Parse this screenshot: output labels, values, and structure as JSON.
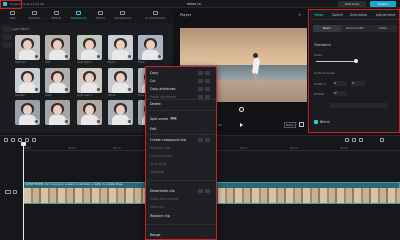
{
  "topbar": {
    "project_name": "Project name 12.22.02",
    "app_title": "DEMO (3)",
    "shortcuts_label": "Shortcuts",
    "export_label": "Export"
  },
  "toolbar": {
    "items": [
      {
        "label": "Text",
        "active": false
      },
      {
        "label": "Stickers",
        "active": false
      },
      {
        "label": "Effects",
        "active": false
      },
      {
        "label": "Transitions",
        "active": true
      },
      {
        "label": "Filters",
        "active": false
      },
      {
        "label": "Adjustment",
        "active": false
      },
      {
        "label": "AI Characters",
        "active": false
      }
    ]
  },
  "browser": {
    "category_title": "Light Effect",
    "items": [
      {
        "label": "Glamour"
      },
      {
        "label": "Halo"
      },
      {
        "label": "Light leak 1"
      },
      {
        "label": "Beam"
      },
      {
        "label": "Flash"
      },
      {
        "label": "Sparkle"
      },
      {
        "label": "Glow"
      },
      {
        "label": "Light leak 2"
      },
      {
        "label": "Shine"
      },
      {
        "label": "Flare"
      },
      {
        "label": ""
      },
      {
        "label": ""
      },
      {
        "label": ""
      },
      {
        "label": ""
      },
      {
        "label": ""
      }
    ]
  },
  "player": {
    "title": "Player",
    "timecode": "00:00:00:00 / 00:00:09:02",
    "ratio_label": "Ratio"
  },
  "inspector": {
    "tabs": [
      {
        "label": "Video",
        "active": true
      },
      {
        "label": "Speed",
        "active": false
      },
      {
        "label": "Animation",
        "active": false
      },
      {
        "label": "Adjustment",
        "active": false
      }
    ],
    "segments": [
      {
        "label": "Basic",
        "active": true
      },
      {
        "label": "Remove BG",
        "active": false
      },
      {
        "label": "Mask",
        "active": false
      }
    ],
    "transform_label": "Transform",
    "scale_label": "Scale",
    "scale_value": 1.0,
    "uniform_scale_label": "Uniform scale",
    "position_label": "Position",
    "position_x": "0",
    "position_y": "0",
    "rotate_label": "Rotate",
    "rotate_value": "0°",
    "blend_label": "Blend"
  },
  "timeline": {
    "ticks": [
      "00:00",
      "00:05",
      "00:10",
      "00:15",
      "00:20",
      "00:25"
    ],
    "clip_title": "SCENE MODEL Girl running on a beach in summer, in light, in a white dress"
  },
  "context_menu": {
    "items": [
      {
        "label": "Copy",
        "enabled": true,
        "shortcut": true
      },
      {
        "label": "Cut",
        "enabled": true,
        "shortcut": true
      },
      {
        "label": "Copy attributes",
        "enabled": true,
        "shortcut": true
      },
      {
        "label": "Paste attributes",
        "enabled": false,
        "shortcut": true
      },
      {
        "label": "Delete",
        "enabled": true,
        "shortcut": false
      },
      {
        "label": "Split scene",
        "enabled": true,
        "shortcut": false,
        "badge": "Free"
      },
      {
        "label": "Edit",
        "enabled": true,
        "submenu": true
      },
      {
        "label": "Create compound clip",
        "enabled": true,
        "shortcut": true
      },
      {
        "label": "Replace clip",
        "enabled": false
      },
      {
        "label": "Link to media",
        "enabled": false
      },
      {
        "label": "Crop to fit",
        "enabled": false
      },
      {
        "label": "Stabilize",
        "enabled": false
      },
      {
        "label": "Deactivate clip",
        "enabled": true,
        "shortcut": true
      },
      {
        "label": "Show thumbnails",
        "enabled": false
      },
      {
        "label": "Hide clip",
        "enabled": false
      },
      {
        "label": "Replace clip",
        "enabled": true
      },
      {
        "label": "Range",
        "enabled": true,
        "submenu": true
      }
    ]
  }
}
